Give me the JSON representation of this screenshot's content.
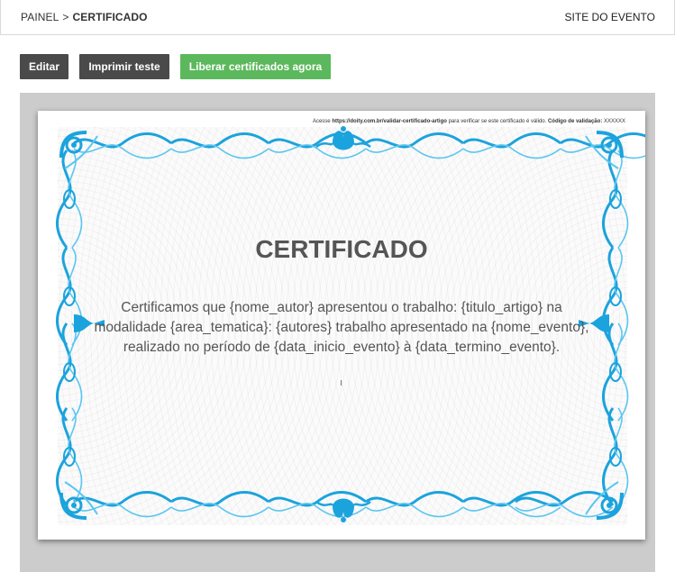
{
  "header": {
    "breadcrumb_root": "PAINEL",
    "breadcrumb_separator": ">",
    "breadcrumb_current": "CERTIFICADO",
    "site_link": "SITE DO EVENTO"
  },
  "toolbar": {
    "edit_label": "Editar",
    "print_label": "Imprimir teste",
    "release_label": "Liberar certificados agora"
  },
  "certificate": {
    "validation_prefix": "Acesse",
    "validation_url": "https://doity.com.br/validar-certificado-artigo",
    "validation_middle": "para verificar se este certificado é válido.",
    "validation_code_label": "Código de validação:",
    "validation_code": "XXXXXX",
    "title": "CERTIFICADO",
    "body": "Certificamos que {nome_autor} apresentou o trabalho: {titulo_artigo} na modalidade {area_tematica}: {autores} trabalho apresentado na {nome_evento}, realizado no período de {data_inicio_evento} à {data_termino_evento}."
  },
  "colors": {
    "frame_blue": "#1ba3dd",
    "button_dark": "#4a4a4a",
    "button_green": "#5cb85c",
    "stage_gray": "#cccccc"
  }
}
